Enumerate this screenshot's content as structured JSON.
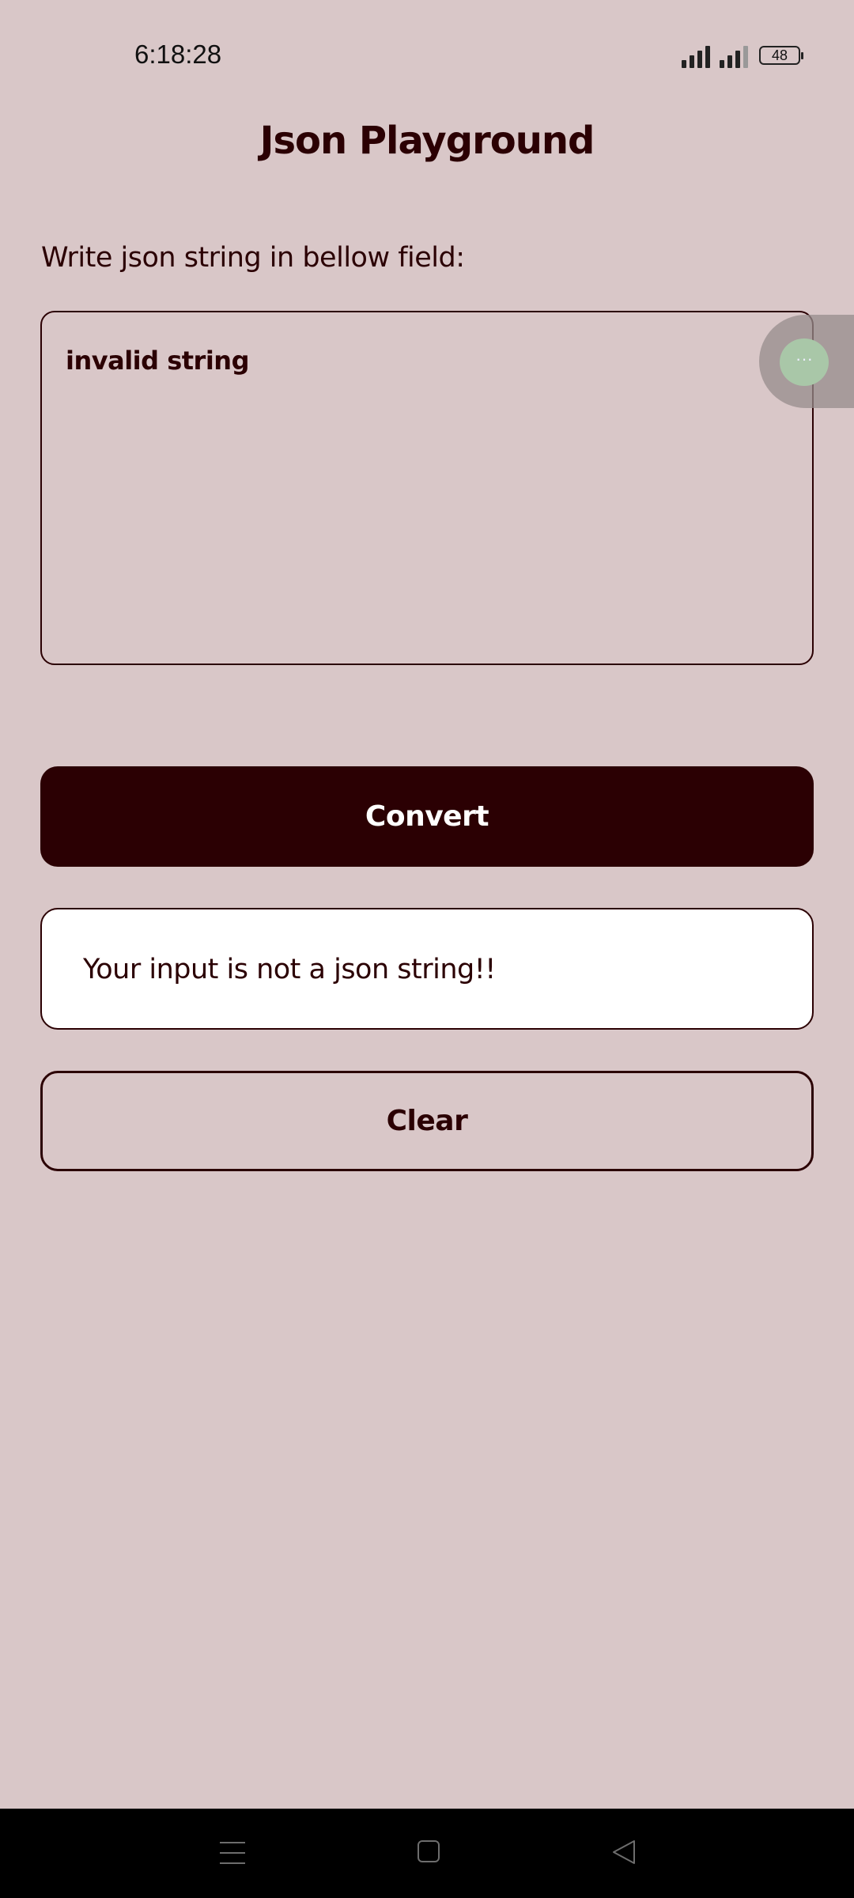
{
  "status_bar": {
    "time": "6:18:28",
    "battery": "48",
    "icons": [
      "signal-icon",
      "signal-icon",
      "battery-icon"
    ]
  },
  "header": {
    "title": "Json Playground"
  },
  "form": {
    "label": "Write json string in bellow field:",
    "input_value": "invalid string",
    "convert_label": "Convert",
    "clear_label": "Clear"
  },
  "result": {
    "message": "Your input is not a json string!!"
  },
  "floating_bubble": {
    "icon": "more-dots-icon",
    "glyph": "···"
  },
  "navigation": {
    "icons": [
      "menu-icon",
      "home-icon",
      "back-icon"
    ]
  },
  "colors": {
    "background": "#d9c7c8",
    "primary": "#2b0003",
    "surface": "#ffffff",
    "nav_bar": "#000000"
  }
}
